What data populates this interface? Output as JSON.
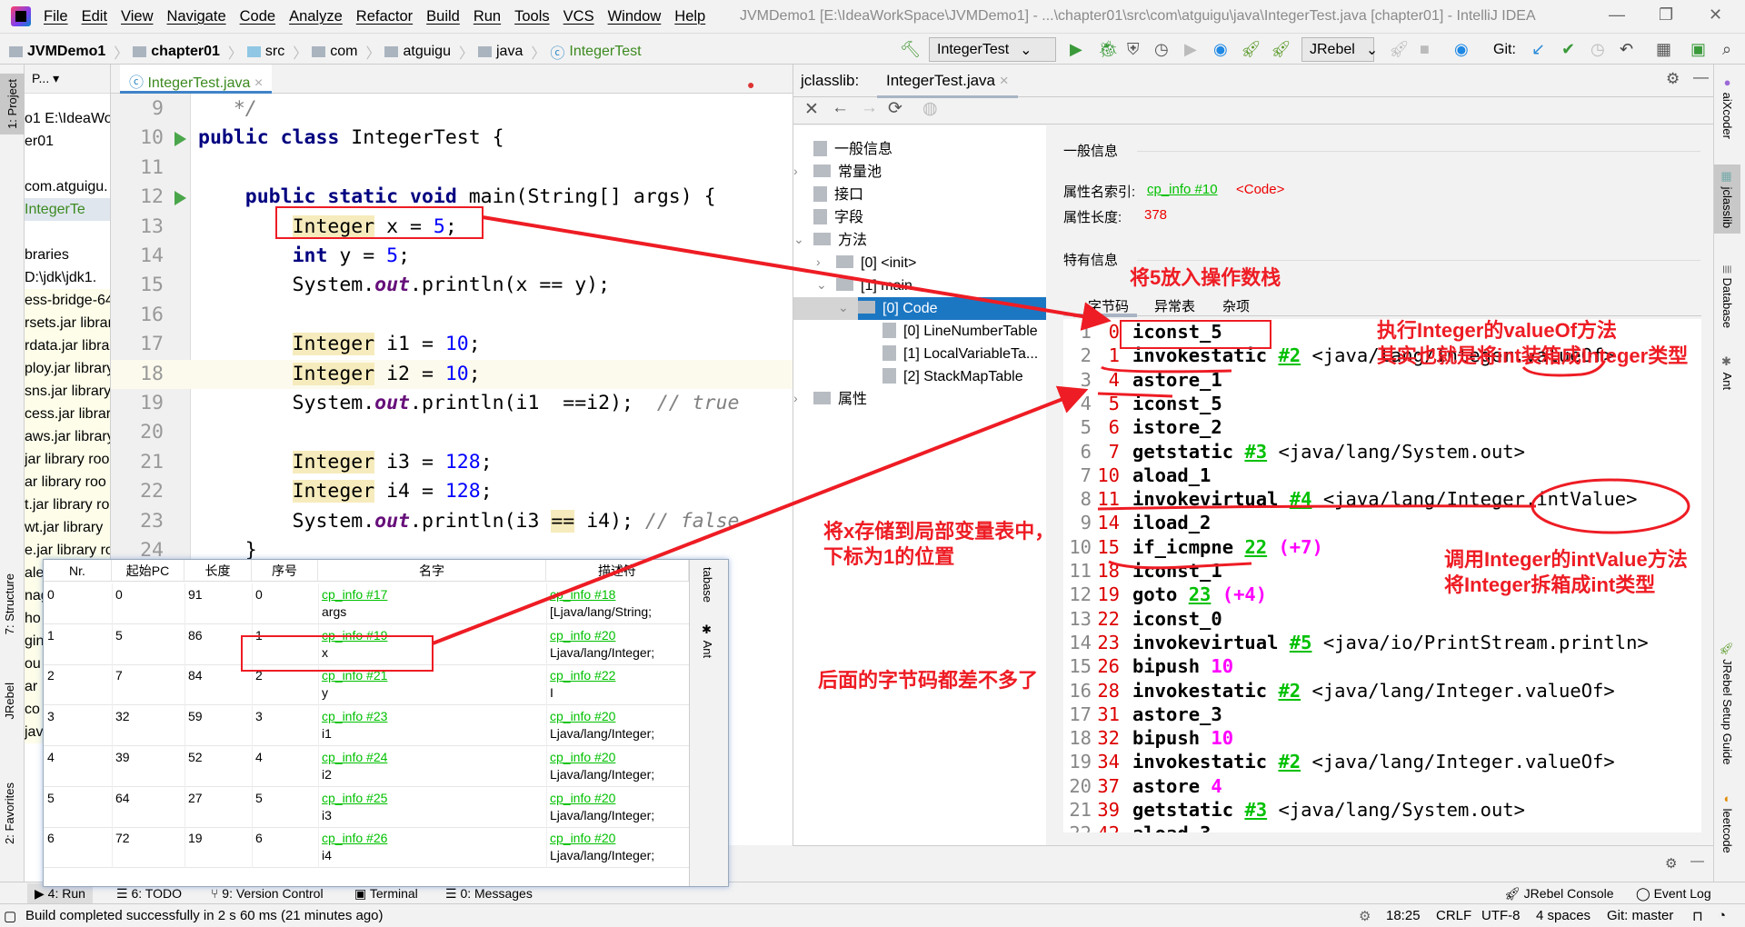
{
  "window": {
    "title": "JVMDemo1 [E:\\IdeaWorkSpace\\JVMDemo1] - ...\\chapter01\\src\\com\\atguigu\\java\\IntegerTest.java [chapter01] - IntelliJ IDEA",
    "menu": [
      "File",
      "Edit",
      "View",
      "Navigate",
      "Code",
      "Analyze",
      "Refactor",
      "Build",
      "Run",
      "Tools",
      "VCS",
      "Window",
      "Help"
    ]
  },
  "breadcrumb": [
    "JVMDemo1",
    "chapter01",
    "src",
    "com",
    "atguigu",
    "java",
    "IntegerTest"
  ],
  "toolbar": {
    "run_config": "IntegerTest",
    "jrebel_config": "JRebel",
    "git_label": "Git:"
  },
  "left_stripe": {
    "project": "1: Project",
    "structure": "7: Structure",
    "jrebel": "JRebel",
    "favorites": "2: Favorites"
  },
  "project": {
    "header": "P...",
    "items": [
      "o1  E:\\IdeaWo",
      "er01",
      "",
      "com.atguigu.",
      "IntegerTe",
      "",
      "braries",
      "D:\\jdk\\jdk1.",
      "ess-bridge-64",
      "rsets.jar library",
      "rdata.jar library",
      "ploy.jar library",
      "sns.jar library",
      "cess.jar library",
      "aws.jar library",
      "jar library roo",
      "ar library roo",
      "t.jar library ro",
      "wt.jar library",
      "e.jar library ro",
      "ale data jar lib",
      "nag",
      "ho",
      "gin",
      "ou",
      "ar",
      "co",
      "jav",
      "",
      "",
      "",
      "",
      "",
      "",
      "R"
    ]
  },
  "editor": {
    "tab": "IntegerTest.java",
    "lines": [
      {
        "n": "9",
        "tokens": [
          [
            "   */",
            "cmt"
          ]
        ]
      },
      {
        "n": "10",
        "run": true,
        "tokens": [
          [
            "public class ",
            "kw"
          ],
          [
            "IntegerTest {",
            ""
          ]
        ]
      },
      {
        "n": "11",
        "tokens": []
      },
      {
        "n": "12",
        "run": true,
        "tokens": [
          [
            "    public static void ",
            "kw"
          ],
          [
            "main(String[] args) {",
            ""
          ]
        ]
      },
      {
        "n": "13",
        "tokens": [
          [
            "        ",
            ""
          ],
          [
            "Integer",
            "hl"
          ],
          [
            " x = ",
            ""
          ],
          [
            "5",
            "num"
          ],
          [
            ";",
            ""
          ]
        ]
      },
      {
        "n": "14",
        "tokens": [
          [
            "        ",
            ""
          ],
          [
            "int ",
            "kw"
          ],
          [
            "y = ",
            ""
          ],
          [
            "5",
            "num"
          ],
          [
            ";",
            ""
          ]
        ]
      },
      {
        "n": "15",
        "tokens": [
          [
            "        System.",
            ""
          ],
          [
            "out",
            "out"
          ],
          [
            ".println(x == y);",
            ""
          ]
        ]
      },
      {
        "n": "16",
        "tokens": []
      },
      {
        "n": "17",
        "tokens": [
          [
            "        ",
            ""
          ],
          [
            "Integer",
            "hl"
          ],
          [
            " i1 = ",
            ""
          ],
          [
            "10",
            "num"
          ],
          [
            ";",
            ""
          ]
        ]
      },
      {
        "n": "18",
        "current": true,
        "tokens": [
          [
            "        ",
            ""
          ],
          [
            "Integer",
            "hl"
          ],
          [
            " i2 = ",
            ""
          ],
          [
            "10",
            "num"
          ],
          [
            ";",
            ""
          ]
        ]
      },
      {
        "n": "19",
        "tokens": [
          [
            "        System.",
            ""
          ],
          [
            "out",
            "out"
          ],
          [
            ".println(i1  ==i2);  ",
            ""
          ],
          [
            "// true",
            "cmt"
          ]
        ]
      },
      {
        "n": "20",
        "tokens": []
      },
      {
        "n": "21",
        "tokens": [
          [
            "        ",
            ""
          ],
          [
            "Integer",
            "hl"
          ],
          [
            " i3 = ",
            ""
          ],
          [
            "128",
            "num"
          ],
          [
            ";",
            ""
          ]
        ]
      },
      {
        "n": "22",
        "tokens": [
          [
            "        ",
            ""
          ],
          [
            "Integer",
            "hl"
          ],
          [
            " i4 = ",
            ""
          ],
          [
            "128",
            "num"
          ],
          [
            ";",
            ""
          ]
        ]
      },
      {
        "n": "23",
        "tokens": [
          [
            "        System.",
            ""
          ],
          [
            "out",
            "out"
          ],
          [
            ".println(i3 ",
            ""
          ],
          [
            "==",
            "hl"
          ],
          [
            " i4); ",
            ""
          ],
          [
            "// false",
            "cmt"
          ]
        ]
      },
      {
        "n": "24",
        "tokens": [
          [
            "    }",
            ""
          ]
        ]
      }
    ]
  },
  "jclasslib": {
    "label": "jclasslib:",
    "tab": "IntegerTest.java",
    "tree": [
      {
        "label": "一般信息",
        "level": 0,
        "type": "file"
      },
      {
        "label": "常量池",
        "level": 0,
        "type": "folder",
        "chev": "›"
      },
      {
        "label": "接口",
        "level": 0,
        "type": "file"
      },
      {
        "label": "字段",
        "level": 0,
        "type": "file"
      },
      {
        "label": "方法",
        "level": 0,
        "type": "folder",
        "chev": "⌄"
      },
      {
        "label": "[0] <init>",
        "level": 1,
        "type": "folder",
        "chev": "›"
      },
      {
        "label": "[1] main",
        "level": 1,
        "type": "folder",
        "chev": "⌄"
      },
      {
        "label": "[0] Code",
        "level": 2,
        "type": "folder",
        "chev": "⌄",
        "selected": true
      },
      {
        "label": "[0] LineNumberTable",
        "level": 3,
        "type": "file"
      },
      {
        "label": "[1] LocalVariableTa...",
        "level": 3,
        "type": "file"
      },
      {
        "label": "[2] StackMapTable",
        "level": 3,
        "type": "file"
      },
      {
        "label": "属性",
        "level": 0,
        "type": "folder",
        "chev": "›"
      }
    ],
    "info": {
      "general_heading": "一般信息",
      "name_index_label": "属性名索引:",
      "name_index_link": "cp_info #10",
      "name_index_value": "<Code>",
      "length_label": "属性长度:",
      "length_value": "378",
      "specific_heading": "特有信息",
      "tabs": [
        "字节码",
        "异常表",
        "杂项"
      ]
    },
    "bytecode": [
      {
        "n": "1",
        "pc": "0",
        "op": "iconst_5"
      },
      {
        "n": "2",
        "pc": "1",
        "op": "invokestatic",
        "ref": "#2",
        "arg": "<java/lang/Integer.valueOf>"
      },
      {
        "n": "3",
        "pc": "4",
        "op": "astore_1"
      },
      {
        "n": "4",
        "pc": "5",
        "op": "iconst_5"
      },
      {
        "n": "5",
        "pc": "6",
        "op": "istore_2"
      },
      {
        "n": "6",
        "pc": "7",
        "op": "getstatic",
        "ref": "#3",
        "arg": "<java/lang/System.out>"
      },
      {
        "n": "7",
        "pc": "10",
        "op": "aload_1"
      },
      {
        "n": "8",
        "pc": "11",
        "op": "invokevirtual",
        "ref": "#4",
        "arg": "<java/lang/Integer.intValue>"
      },
      {
        "n": "9",
        "pc": "14",
        "op": "iload_2"
      },
      {
        "n": "10",
        "pc": "15",
        "op": "if_icmpne",
        "ref": "22",
        "extra": "(+7)"
      },
      {
        "n": "11",
        "pc": "18",
        "op": "iconst_1"
      },
      {
        "n": "12",
        "pc": "19",
        "op": "goto",
        "ref": "23",
        "extra": "(+4)"
      },
      {
        "n": "13",
        "pc": "22",
        "op": "iconst_0"
      },
      {
        "n": "14",
        "pc": "23",
        "op": "invokevirtual",
        "ref": "#5",
        "arg": "<java/io/PrintStream.println>"
      },
      {
        "n": "15",
        "pc": "26",
        "op": "bipush",
        "extra": "10"
      },
      {
        "n": "16",
        "pc": "28",
        "op": "invokestatic",
        "ref": "#2",
        "arg": "<java/lang/Integer.valueOf>"
      },
      {
        "n": "17",
        "pc": "31",
        "op": "astore_3"
      },
      {
        "n": "18",
        "pc": "32",
        "op": "bipush",
        "extra": "10"
      },
      {
        "n": "19",
        "pc": "34",
        "op": "invokestatic",
        "ref": "#2",
        "arg": "<java/lang/Integer.valueOf>"
      },
      {
        "n": "20",
        "pc": "37",
        "op": "astore",
        "extra": "4"
      },
      {
        "n": "21",
        "pc": "39",
        "op": "getstatic",
        "ref": "#3",
        "arg": "<java/lang/System.out>"
      },
      {
        "n": "22",
        "pc": "42",
        "op": "aload_3"
      }
    ]
  },
  "right_stripe": [
    "aiXcoder",
    "jclasslib",
    "Database",
    "Ant",
    "JRebel Setup Guide",
    "leetcode"
  ],
  "local_variable_table": {
    "headers": [
      "Nr.",
      "起始PC",
      "长度",
      "序号",
      "名字",
      "描述符"
    ],
    "rows": [
      {
        "nr": "0",
        "start": "0",
        "len": "91",
        "idx": "0",
        "name_ref": "cp_info #17",
        "name": "args",
        "desc_ref": "cp_info #18",
        "desc": "[Ljava/lang/String;"
      },
      {
        "nr": "1",
        "start": "5",
        "len": "86",
        "idx": "1",
        "name_ref": "cp_info #19",
        "name": "x",
        "desc_ref": "cp_info #20",
        "desc": "Ljava/lang/Integer;"
      },
      {
        "nr": "2",
        "start": "7",
        "len": "84",
        "idx": "2",
        "name_ref": "cp_info #21",
        "name": "y",
        "desc_ref": "cp_info #22",
        "desc": "I"
      },
      {
        "nr": "3",
        "start": "32",
        "len": "59",
        "idx": "3",
        "name_ref": "cp_info #23",
        "name": "i1",
        "desc_ref": "cp_info #20",
        "desc": "Ljava/lang/Integer;"
      },
      {
        "nr": "4",
        "start": "39",
        "len": "52",
        "idx": "4",
        "name_ref": "cp_info #24",
        "name": "i2",
        "desc_ref": "cp_info #20",
        "desc": "Ljava/lang/Integer;"
      },
      {
        "nr": "5",
        "start": "64",
        "len": "27",
        "idx": "5",
        "name_ref": "cp_info #25",
        "name": "i3",
        "desc_ref": "cp_info #20",
        "desc": "Ljava/lang/Integer;"
      },
      {
        "nr": "6",
        "start": "72",
        "len": "19",
        "idx": "6",
        "name_ref": "cp_info #26",
        "name": "i4",
        "desc_ref": "cp_info #20",
        "desc": "Ljava/lang/Integer;"
      }
    ],
    "strip": [
      "tabase",
      "Ant"
    ]
  },
  "annotations": {
    "push5": "将5放入操作数栈",
    "valueof1": "执行Integer的valueOf方法",
    "valueof2": "其实也就是将int装箱成Integer类型",
    "store1": "将x存储到局部变量表中，",
    "store2": "下标为1的位置",
    "intvalue1": "调用Integer的intValue方法",
    "intvalue2": "将Integer拆箱成int类型",
    "rest": "后面的字节码都差不多了",
    "color": "#ee1c24"
  },
  "tool_windows": {
    "left": [
      "4: Run",
      "6: TODO",
      "9: Version Control",
      "Terminal",
      "0: Messages"
    ],
    "right": [
      "JRebel Console",
      "Event Log"
    ]
  },
  "status": {
    "message": "Build completed successfully in 2 s 60 ms (21 minutes ago)",
    "position": "18:25",
    "line_sep": "CRLF",
    "encoding": "UTF-8",
    "indent": "4 spaces",
    "git": "Git: master"
  }
}
